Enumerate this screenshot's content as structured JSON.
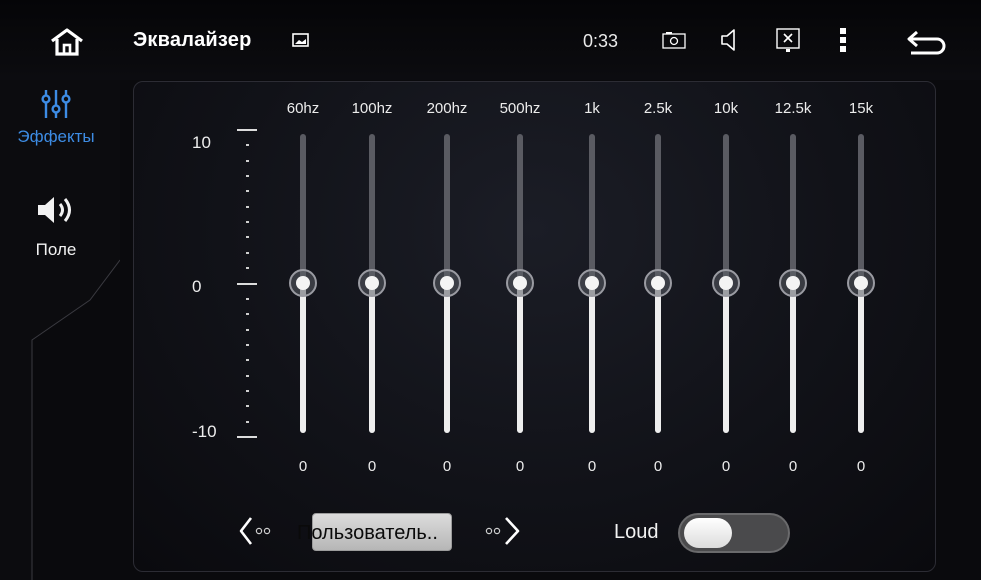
{
  "app": {
    "title": "Эквалайзер",
    "time": "0:33"
  },
  "icons": {
    "home": "home-icon",
    "gallery": "gallery-icon",
    "screenshot": "screenshot-icon",
    "volume": "volume-icon",
    "close_screen": "close-screen-icon",
    "menu": "menu-icon",
    "back": "back-icon"
  },
  "sidebar": {
    "items": [
      {
        "label": "Эффекты",
        "icon": "equalizer-icon",
        "active": true
      },
      {
        "label": "Поле",
        "icon": "speaker-icon",
        "active": false
      }
    ]
  },
  "equalizer": {
    "scale": {
      "max": "10",
      "mid": "0",
      "min": "-10"
    },
    "bands": [
      {
        "freq": "60hz",
        "value": "0"
      },
      {
        "freq": "100hz",
        "value": "0"
      },
      {
        "freq": "200hz",
        "value": "0"
      },
      {
        "freq": "500hz",
        "value": "0"
      },
      {
        "freq": "1k",
        "value": "0"
      },
      {
        "freq": "2.5k",
        "value": "0"
      },
      {
        "freq": "10k",
        "value": "0"
      },
      {
        "freq": "12.5k",
        "value": "0"
      },
      {
        "freq": "15k",
        "value": "0"
      }
    ],
    "preset": "Пользователь..",
    "loud_label": "Loud",
    "loud_enabled": false
  },
  "colors": {
    "accent": "#3d8ce4",
    "background": "#0a0a0d"
  }
}
